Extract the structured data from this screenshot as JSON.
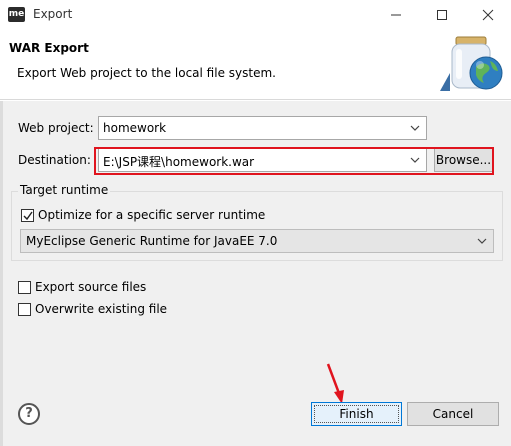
{
  "window": {
    "app_badge": "me",
    "title": "Export"
  },
  "banner": {
    "title": "WAR Export",
    "description": "Export Web project to the local file system."
  },
  "form": {
    "web_project_label": "Web project:",
    "web_project_value": "homework",
    "destination_label": "Destination:",
    "destination_value": "E:\\JSP课程\\homework.war",
    "browse_label": "Browse..."
  },
  "target_runtime": {
    "group_title": "Target runtime",
    "optimize_label": "Optimize for a specific server runtime",
    "optimize_checked": true,
    "runtime_value": "MyEclipse Generic Runtime for JavaEE 7.0"
  },
  "options": {
    "export_source_label": "Export source files",
    "export_source_checked": false,
    "overwrite_label": "Overwrite existing file",
    "overwrite_checked": false
  },
  "footer": {
    "help_glyph": "?",
    "finish_label": "Finish",
    "cancel_label": "Cancel"
  },
  "colors": {
    "highlight": "#e0141e",
    "default_button_border": "#0078d7"
  },
  "icons": {
    "banner": "jar-globe-icon",
    "minimize": "minimize-icon",
    "maximize": "maximize-icon",
    "close": "close-icon"
  }
}
